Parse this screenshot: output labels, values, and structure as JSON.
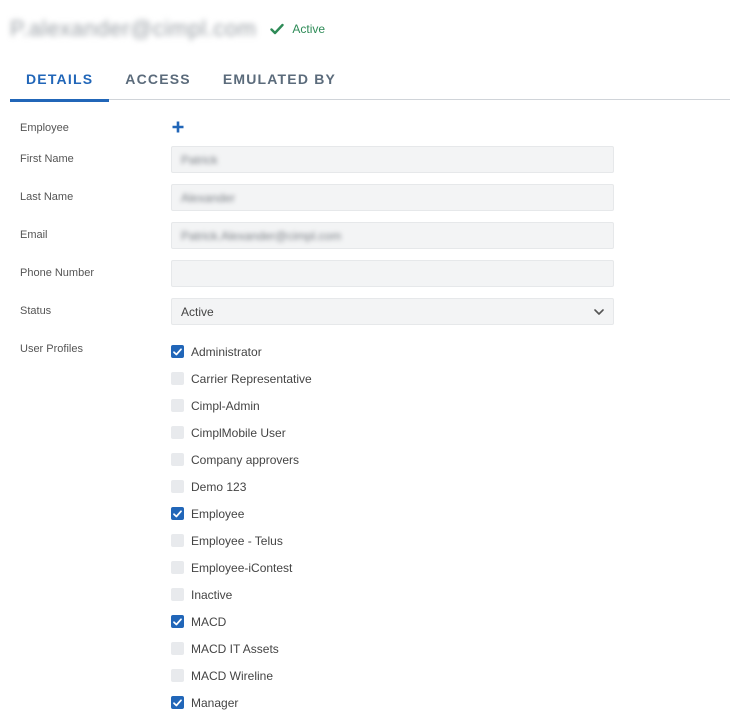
{
  "header": {
    "user_email": "P.alexander@cimpl.com",
    "status": "Active",
    "status_color": "#2e8b57"
  },
  "tabs": [
    {
      "label": "DETAILS",
      "active": true
    },
    {
      "label": "ACCESS",
      "active": false
    },
    {
      "label": "EMULATED BY",
      "active": false
    }
  ],
  "form": {
    "employee_label": "Employee",
    "first_name_label": "First Name",
    "first_name_value": "Patrick",
    "last_name_label": "Last Name",
    "last_name_value": "Alexander",
    "email_label": "Email",
    "email_value": "Patrick.Alexander@cimpl.com",
    "phone_label": "Phone Number",
    "phone_value": "",
    "status_label": "Status",
    "status_value": "Active",
    "profiles_label": "User Profiles"
  },
  "profiles": [
    {
      "label": "Administrator",
      "checked": true
    },
    {
      "label": "Carrier Representative",
      "checked": false
    },
    {
      "label": "Cimpl-Admin",
      "checked": false
    },
    {
      "label": "CimplMobile User",
      "checked": false
    },
    {
      "label": "Company approvers",
      "checked": false
    },
    {
      "label": "Demo 123",
      "checked": false
    },
    {
      "label": "Employee",
      "checked": true
    },
    {
      "label": "Employee - Telus",
      "checked": false
    },
    {
      "label": "Employee-iContest",
      "checked": false
    },
    {
      "label": "Inactive",
      "checked": false
    },
    {
      "label": "MACD",
      "checked": true
    },
    {
      "label": "MACD IT Assets",
      "checked": false
    },
    {
      "label": "MACD Wireline",
      "checked": false
    },
    {
      "label": "Manager",
      "checked": true
    }
  ],
  "colors": {
    "accent": "#2166b8",
    "field_bg": "#f3f4f5",
    "checkbox_unchecked": "#e8eaed"
  },
  "icons": {
    "status": "checkmark-icon",
    "add_employee": "plus-icon",
    "status_select": "chevron-down-icon",
    "checkbox": "checkbox-check-icon"
  }
}
